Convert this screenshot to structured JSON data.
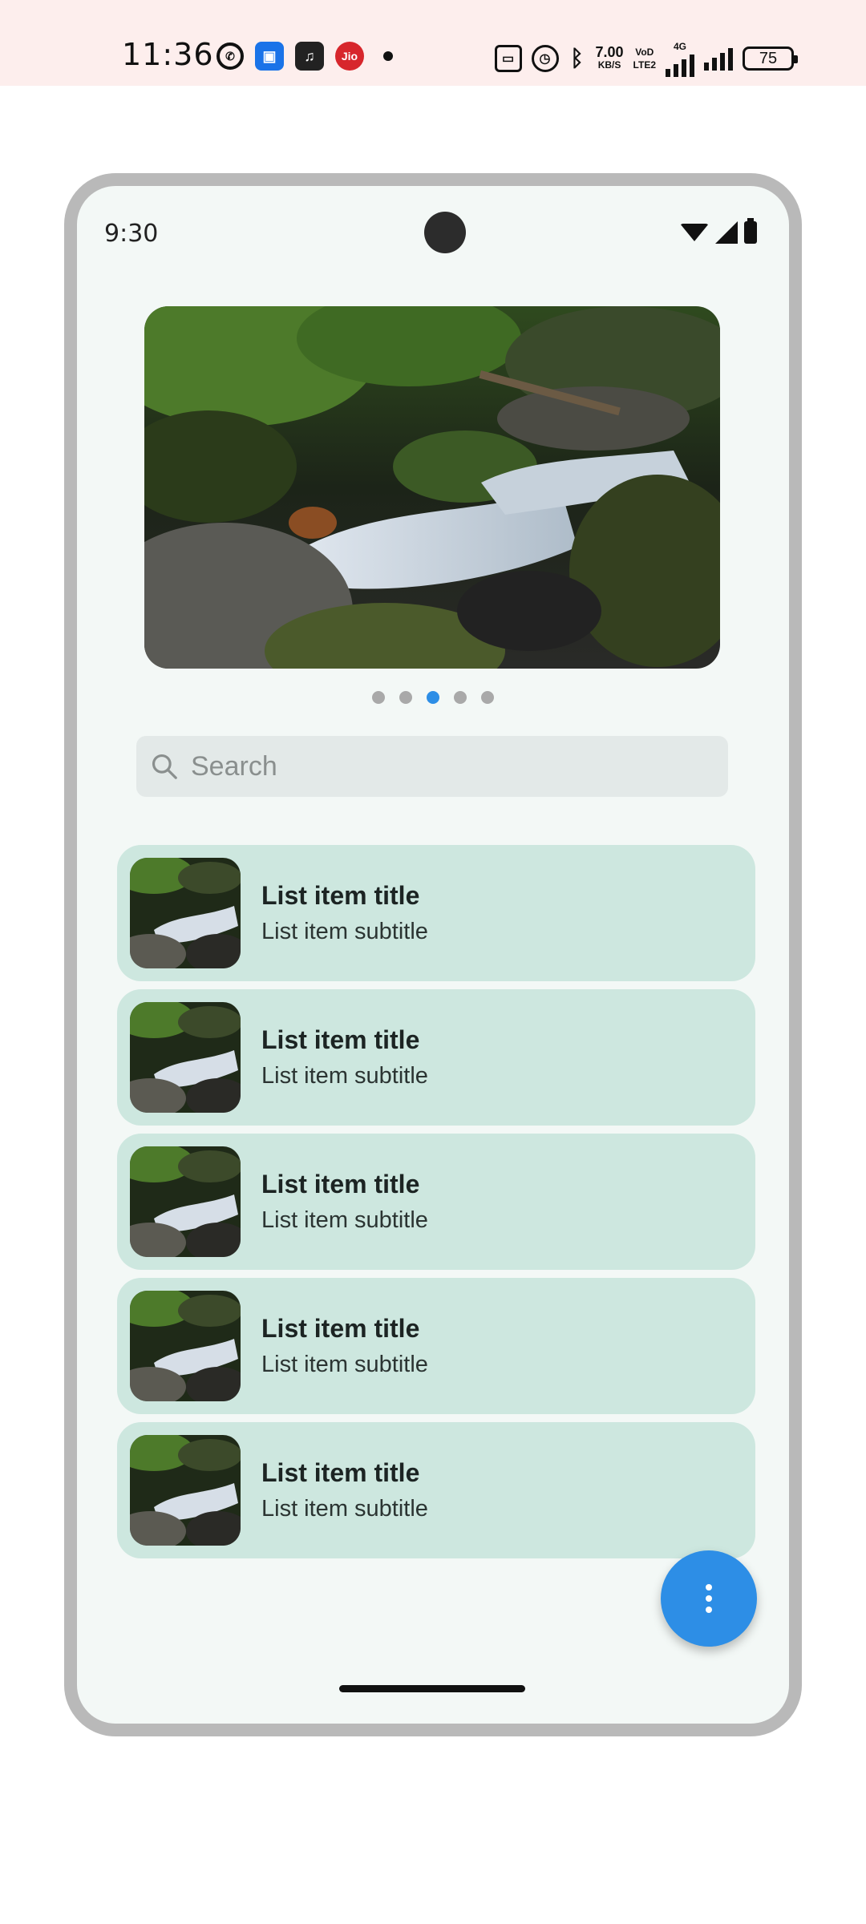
{
  "host_status_bar": {
    "time": "11:36",
    "net_speed_value": "7.00",
    "net_speed_unit": "KB/S",
    "volte_label_1": "VoD",
    "volte_label_2": "LTE2",
    "network_type": "4G",
    "battery_level": "75",
    "app_icons": [
      "whatsapp-icon",
      "app-blue-icon",
      "app-dark-icon",
      "jio-icon"
    ]
  },
  "device": {
    "status_time": "9:30"
  },
  "carousel": {
    "page_count": 5,
    "active_index": 2
  },
  "search": {
    "placeholder": "Search"
  },
  "list": {
    "items": [
      {
        "title": "List item title",
        "subtitle": "List item subtitle"
      },
      {
        "title": "List item title",
        "subtitle": "List item subtitle"
      },
      {
        "title": "List item title",
        "subtitle": "List item subtitle"
      },
      {
        "title": "List item title",
        "subtitle": "List item subtitle"
      },
      {
        "title": "List item title",
        "subtitle": "List item subtitle"
      }
    ]
  },
  "fab": {
    "icon": "more-vert-icon"
  },
  "colors": {
    "accent": "#2d8ee6",
    "list_item_bg": "#cde7df",
    "screen_bg": "#f3f8f6",
    "host_status_bg": "#fdeeed"
  }
}
